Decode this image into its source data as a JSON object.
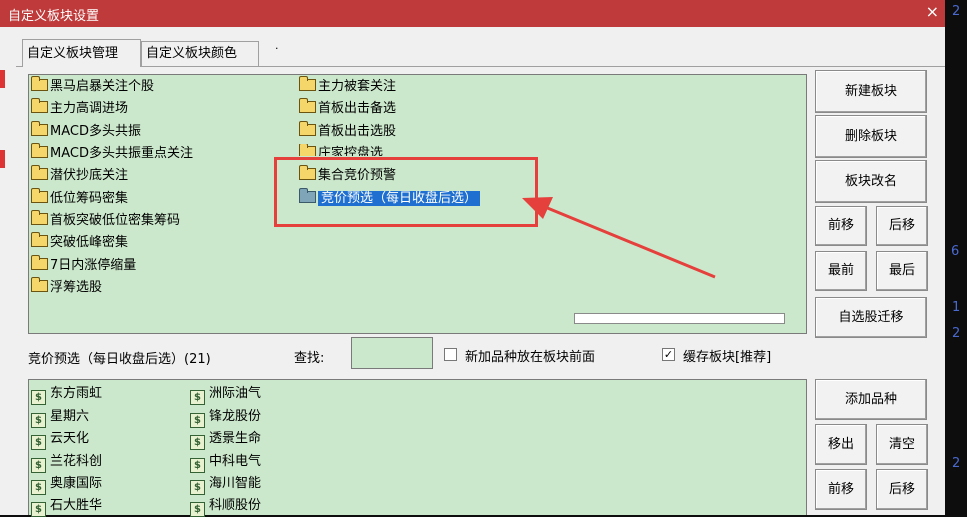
{
  "window": {
    "title": "自定义板块设置",
    "close": "×"
  },
  "tabs": [
    {
      "label": "自定义板块管理"
    },
    {
      "label": "自定义板块颜色"
    }
  ],
  "stray_dot": "·",
  "blocks": {
    "col1": [
      "黑马启暴关注个股",
      "主力高调进场",
      "MACD多头共振",
      "MACD多头共振重点关注",
      "潜伏抄底关注",
      "低位筹码密集",
      "首板突破低位密集筹码",
      "突破低峰密集",
      "7日内涨停缩量",
      "浮筹选股"
    ],
    "col2": [
      "主力被套关注",
      "首板出击备选",
      "首板出击选股",
      "庄家控盘选",
      "集合竞价预警",
      "竞价预选（每日收盘后选）"
    ]
  },
  "side_buttons": {
    "new_block": "新建板块",
    "delete_block": "删除板块",
    "rename_block": "板块改名",
    "move_up": "前移",
    "move_down": "后移",
    "move_first": "最前",
    "move_last": "最后",
    "migrate": "自选股迁移"
  },
  "middle": {
    "current_block_label": "竞价预选（每日收盘后选）(21)",
    "search_label": "查找:",
    "opt_new_front": "新加品种放在板块前面",
    "opt_new_front_checked": false,
    "opt_cache": "缓存板块[推荐]",
    "opt_cache_checked": true,
    "check_mark": "✓"
  },
  "stocks": {
    "col1": [
      "东方雨虹",
      "星期六",
      "云天化",
      "兰花科创",
      "奥康国际",
      "石大胜华"
    ],
    "col2": [
      "洲际油气",
      "锋龙股份",
      "透景生命",
      "中科电气",
      "海川智能",
      "科顺股份"
    ],
    "icon_glyph": "$"
  },
  "bottom_buttons": {
    "add": "添加品种",
    "remove": "移出",
    "clear": "清空",
    "move_up": "前移",
    "move_down": "后移"
  },
  "background_chars": [
    "2",
    "6",
    "1",
    "2",
    "2"
  ],
  "colors": {
    "titlebar": "#bf3a3a",
    "panel": "#cce8cc",
    "selection": "#1e6fd0",
    "annotation": "#e5403c"
  }
}
